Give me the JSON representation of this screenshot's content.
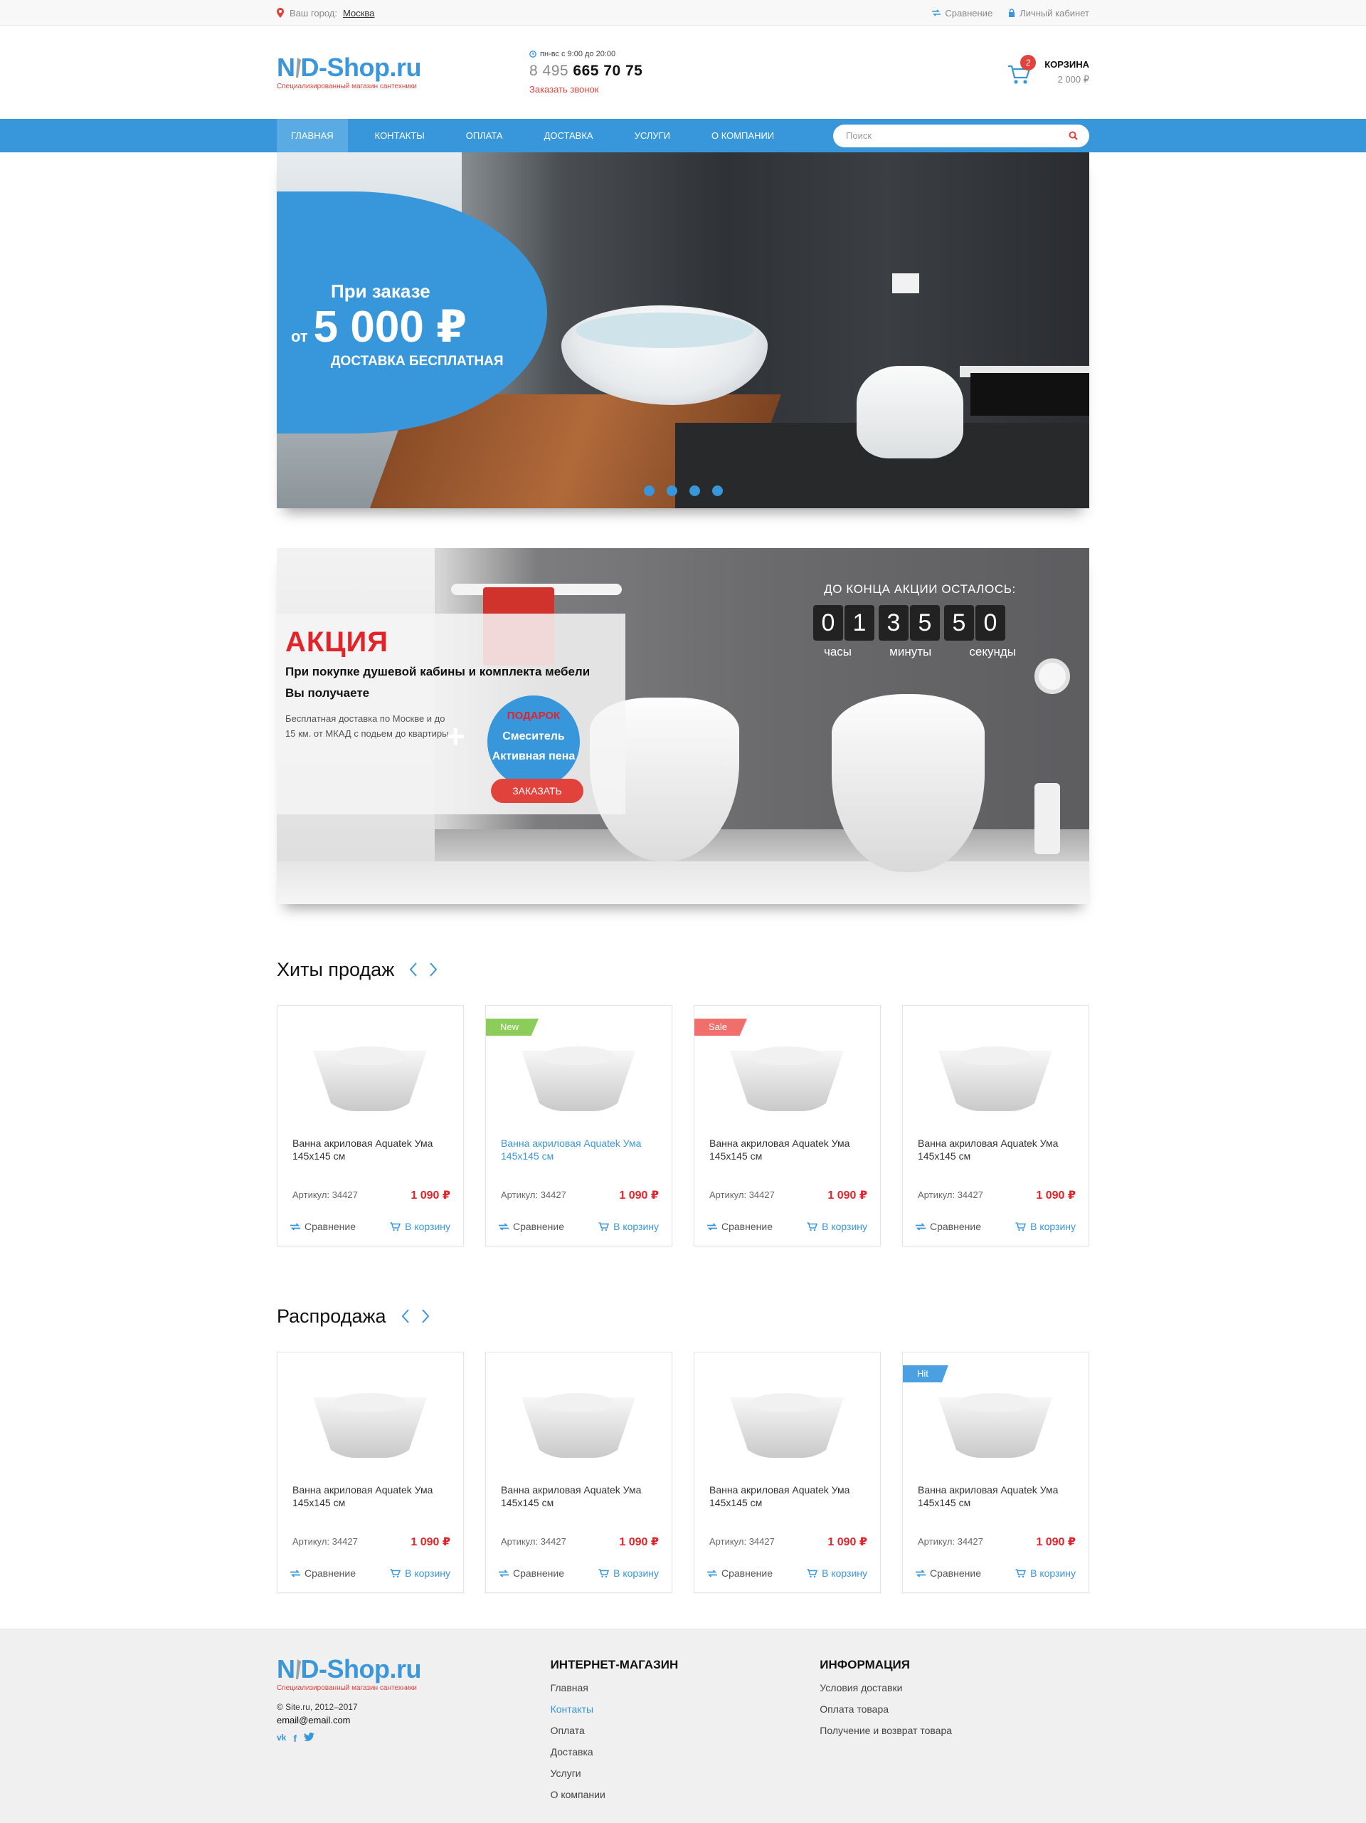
{
  "topbar": {
    "city_label": "Ваш город:",
    "city_value": "Москва",
    "compare": "Сравнение",
    "account": "Личный кабинет"
  },
  "header": {
    "logo_part1": "N",
    "logo_part2": "D-Shop.ru",
    "logo_tagline": "Специализированный магазин сантехники",
    "hours": "пн-вс с 9:00 до 20:00",
    "phone_code": "8 495",
    "phone_number": "665 70 75",
    "callback": "Заказать звонок",
    "cart_count": "2",
    "cart_title": "КОРЗИНА",
    "cart_sum": "2 000 ₽"
  },
  "nav": {
    "items": [
      {
        "label": "Главная"
      },
      {
        "label": "Контакты"
      },
      {
        "label": "Оплата"
      },
      {
        "label": "Доставка"
      },
      {
        "label": "Услуги"
      },
      {
        "label": "О компании"
      }
    ],
    "search_placeholder": "Поиск"
  },
  "hero": {
    "line1": "При заказе",
    "from": "от",
    "amount": "5 000 ₽",
    "line3": "ДОСТАВКА БЕСПЛАТНАЯ",
    "slide_count": 4
  },
  "promo": {
    "title": "АКЦИЯ",
    "subtitle_line1": "При покупке душевой кабины и комплекта мебели",
    "subtitle_line2": "Вы получаете",
    "desc": "Бесплатная доставка по Москве и до 15 км. от МКАД с подьем до квартиры",
    "plus": "+",
    "gift_label": "ПОДАРОК",
    "gift_item1": "Смеситель",
    "gift_item2": "Активная пена",
    "order_button": "Заказать",
    "timer_title": "ДО КОНЦА АКЦИИ ОСТАЛОСЬ:",
    "timer_digits": [
      "0",
      "1",
      "3",
      "5",
      "5",
      "0"
    ],
    "label_hours": "часы",
    "label_minutes": "минуты",
    "label_seconds": "секунды"
  },
  "hits": {
    "title": "Хиты продаж",
    "products": [
      {
        "badge": "",
        "name": "Ванна акриловая Aquatek Ума 145х145 см",
        "article": "Артикул: 34427",
        "price": "1 090 ₽",
        "compare": "Сравнение",
        "to_cart": "В корзину"
      },
      {
        "badge": "New",
        "name": "Ванна акриловая Aquatek Ума 145х145 см",
        "article": "Артикул: 34427",
        "price": "1 090 ₽",
        "compare": "Сравнение",
        "to_cart": "В корзину"
      },
      {
        "badge": "Sale",
        "name": "Ванна акриловая Aquatek Ума 145х145 см",
        "article": "Артикул: 34427",
        "price": "1 090 ₽",
        "compare": "Сравнение",
        "to_cart": "В корзину"
      },
      {
        "badge": "",
        "name": "Ванна акриловая Aquatek Ума 145х145 см",
        "article": "Артикул: 34427",
        "price": "1 090 ₽",
        "compare": "Сравнение",
        "to_cart": "В корзину"
      }
    ]
  },
  "sale": {
    "title": "Распродажа",
    "products": [
      {
        "badge": "",
        "name": "Ванна акриловая Aquatek Ума 145х145 см",
        "article": "Артикул: 34427",
        "price": "1 090 ₽",
        "compare": "Сравнение",
        "to_cart": "В корзину"
      },
      {
        "badge": "",
        "name": "Ванна акриловая Aquatek Ума 145х145 см",
        "article": "Артикул: 34427",
        "price": "1 090 ₽",
        "compare": "Сравнение",
        "to_cart": "В корзину"
      },
      {
        "badge": "",
        "name": "Ванна акриловая Aquatek Ума 145х145 см",
        "article": "Артикул: 34427",
        "price": "1 090 ₽",
        "compare": "Сравнение",
        "to_cart": "В корзину"
      },
      {
        "badge": "Hit",
        "name": "Ванна акриловая Aquatek Ума 145х145 см",
        "article": "Артикул: 34427",
        "price": "1 090 ₽",
        "compare": "Сравнение",
        "to_cart": "В корзину"
      }
    ]
  },
  "footer": {
    "copyright": "© Site.ru, 2012–2017",
    "email": "email@email.com",
    "shop_title": "ИНТЕРНЕТ-МАГАЗИН",
    "shop_links": [
      "Главная",
      "Контакты",
      "Оплата",
      "Доставка",
      "Услуги",
      "О компании"
    ],
    "info_title": "ИНФОРМАЦИЯ",
    "info_links": [
      "Условия доставки",
      "Оплата товара",
      "Получение и возврат товара"
    ]
  },
  "colors": {
    "brand_blue": "#3897da",
    "brand_red": "#e2423c",
    "badge_new": "#8ccd5a",
    "badge_sale": "#f06e6c",
    "badge_hit": "#4aa0e0"
  },
  "icons": [
    "map-pin-icon",
    "compare-icon",
    "lock-icon",
    "clock-icon",
    "cart-icon",
    "search-icon",
    "wrench-icon",
    "arrow-left-icon",
    "arrow-right-icon",
    "vk-icon",
    "facebook-icon",
    "twitter-icon"
  ]
}
